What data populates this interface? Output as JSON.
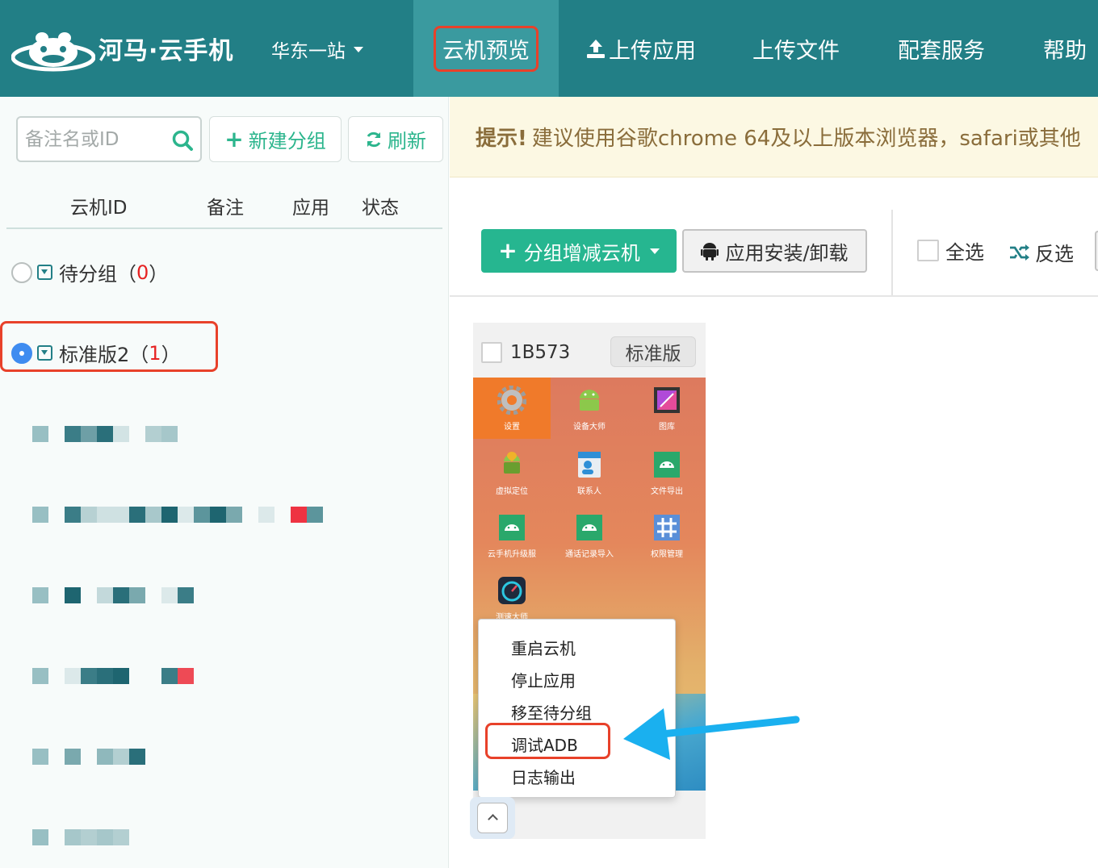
{
  "brand": {
    "name": "河马·云手机"
  },
  "region": {
    "label": "华东一站"
  },
  "nav": {
    "items": [
      {
        "label": "云机预览"
      },
      {
        "label": "上传应用"
      },
      {
        "label": "上传文件"
      },
      {
        "label": "配套服务"
      },
      {
        "label": "帮助"
      }
    ]
  },
  "sidebar": {
    "search_placeholder": "备注名或ID",
    "new_group_label": "新建分组",
    "refresh_label": "刷新",
    "columns": [
      "云机ID",
      "备注",
      "应用",
      "状态"
    ],
    "groups": [
      {
        "name": "待分组（",
        "count": "0",
        "close": "）",
        "selected": false
      },
      {
        "name": "标准版2（",
        "count": "1",
        "close": "）",
        "selected": true
      }
    ]
  },
  "tip": {
    "strong": "提示!",
    "text": "建议使用谷歌chrome 64及以上版本浏览器，safari或其他"
  },
  "toolbar": {
    "group_button": "分组增减云机",
    "install_button": "应用安装/卸载",
    "select_all": "全选",
    "invert": "反选"
  },
  "device": {
    "id": "1B573",
    "edition": "标准版",
    "apps": [
      {
        "label": "设置",
        "icon": "gear-icon"
      },
      {
        "label": "设备大师",
        "icon": "android-icon"
      },
      {
        "label": "图库",
        "icon": "gallery-icon"
      },
      {
        "label": "虚拟定位",
        "icon": "android-location-icon"
      },
      {
        "label": "联系人",
        "icon": "contacts-icon"
      },
      {
        "label": "文件导出",
        "icon": "android-icon"
      },
      {
        "label": "云手机升级服",
        "icon": "android-icon"
      },
      {
        "label": "通话记录导入",
        "icon": "android-icon"
      },
      {
        "label": "权限管理",
        "icon": "hash-icon"
      },
      {
        "label": "测速大师",
        "icon": "speedometer-icon"
      }
    ]
  },
  "context_menu": {
    "items": [
      "重启云机",
      "停止应用",
      "移至待分组",
      "调试ADB",
      "日志输出"
    ]
  },
  "colors": {
    "topbar": "#227f86",
    "accent_green": "#26b690",
    "highlight_red": "#e8412a",
    "arrow_blue": "#1ab0ef"
  }
}
